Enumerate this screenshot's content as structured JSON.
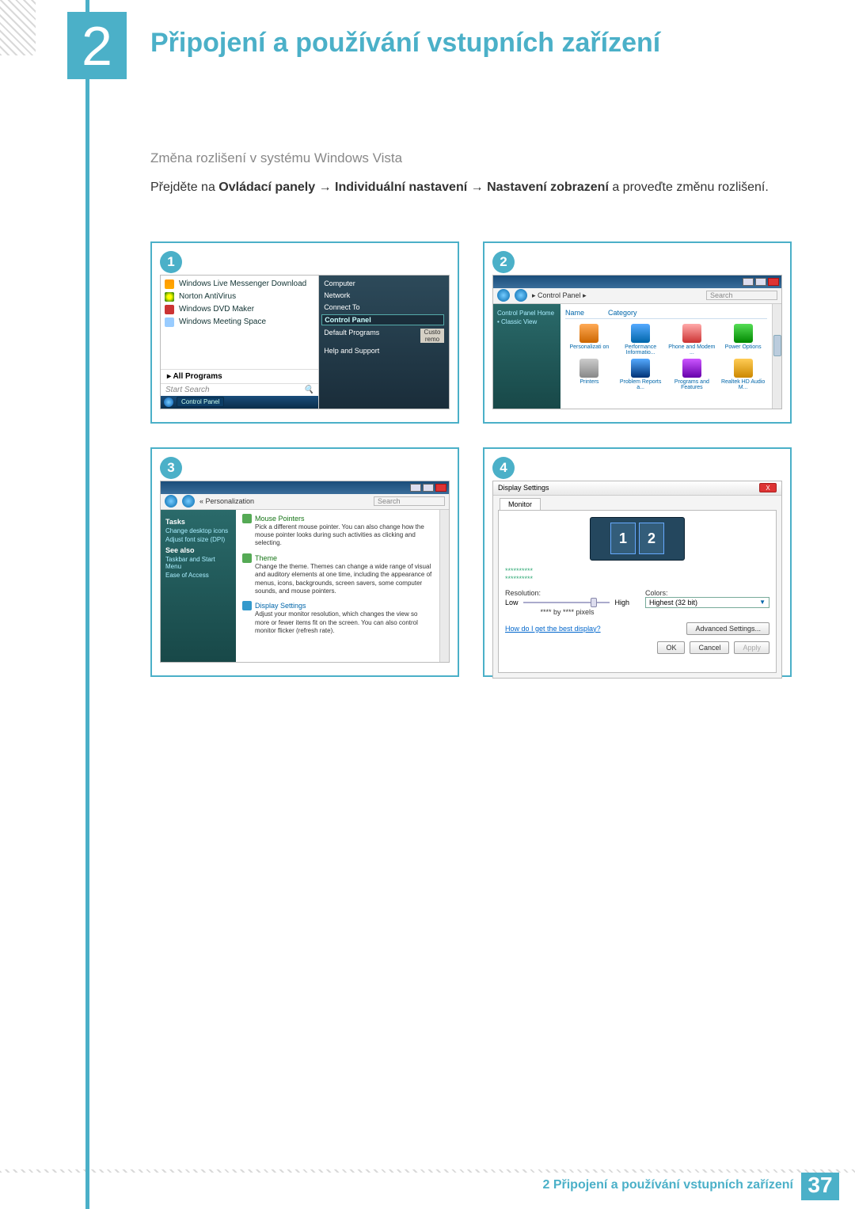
{
  "chapter": {
    "number": "2",
    "title": "Připojení a používání vstupních zařízení"
  },
  "subheading": "Změna rozlišení v systému Windows Vista",
  "instruction": {
    "prefix": "Přejděte na ",
    "b1": "Ovládací panely",
    "arrow": " → ",
    "b2": "Individuální nastavení",
    "b3": "Nastavení zobrazení",
    "suffix": " a proveďte změnu rozlišení."
  },
  "steps": {
    "s1": "1",
    "s2": "2",
    "s3": "3",
    "s4": "4"
  },
  "shot1": {
    "items": {
      "messenger": "Windows Live Messenger Download",
      "norton": "Norton AntiVirus",
      "dvd": "Windows DVD Maker",
      "meeting": "Windows Meeting Space"
    },
    "all_programs": "All Programs",
    "search_placeholder": "Start Search",
    "taskbar_button": "Control Panel",
    "right": {
      "computer": "Computer",
      "network": "Network",
      "connect": "Connect To",
      "control_panel": "Control Panel",
      "default_programs": "Default Programs",
      "custo": "Custo\nremo",
      "help": "Help and Support"
    }
  },
  "shot2": {
    "breadcrumb": "Control Panel ▸",
    "search": "Search",
    "side": {
      "home": "Control Panel Home",
      "classic": "Classic View"
    },
    "header": {
      "name": "Name",
      "category": "Category"
    },
    "items": {
      "personalization": "Personalizati\non",
      "performance": "Performance\nInformatio...",
      "phone": "Phone and\nModem ...",
      "power": "Power\nOptions",
      "printers": "Printers",
      "problem": "Problem\nReports a...",
      "programs": "Programs\nand Features",
      "realtek": "Realtek HD\nAudio M..."
    }
  },
  "shot3": {
    "breadcrumb": "Personalization",
    "search": "Search",
    "side": {
      "tasks": "Tasks",
      "icons": "Change desktop icons",
      "font": "Adjust font size (DPI)",
      "see_also": "See also",
      "taskbar": "Taskbar and Start Menu",
      "ease": "Ease of Access"
    },
    "sections": {
      "pointers": {
        "title": "Mouse Pointers",
        "desc": "Pick a different mouse pointer. You can also change how the mouse pointer looks during such activities as clicking and selecting."
      },
      "theme": {
        "title": "Theme",
        "desc": "Change the theme. Themes can change a wide range of visual and auditory elements at one time, including the appearance of menus, icons, backgrounds, screen savers, some computer sounds, and mouse pointers."
      },
      "display": {
        "title": "Display Settings",
        "desc": "Adjust your monitor resolution, which changes the view so more or fewer items fit on the screen. You can also control monitor flicker (refresh rate)."
      }
    }
  },
  "shot4": {
    "window_title": "Display Settings",
    "tab": "Monitor",
    "mon1": "1",
    "mon2": "2",
    "dots": "**********\n**********",
    "resolution_label": "Resolution:",
    "low": "Low",
    "high": "High",
    "pixels": "**** by **** pixels",
    "colors_label": "Colors:",
    "colors_value": "Highest (32 bit)",
    "help_link": "How do I get the best display?",
    "advanced": "Advanced Settings...",
    "ok": "OK",
    "cancel": "Cancel",
    "apply": "Apply"
  },
  "footer": {
    "text": "2 Připojení a používání vstupních zařízení",
    "page": "37"
  }
}
